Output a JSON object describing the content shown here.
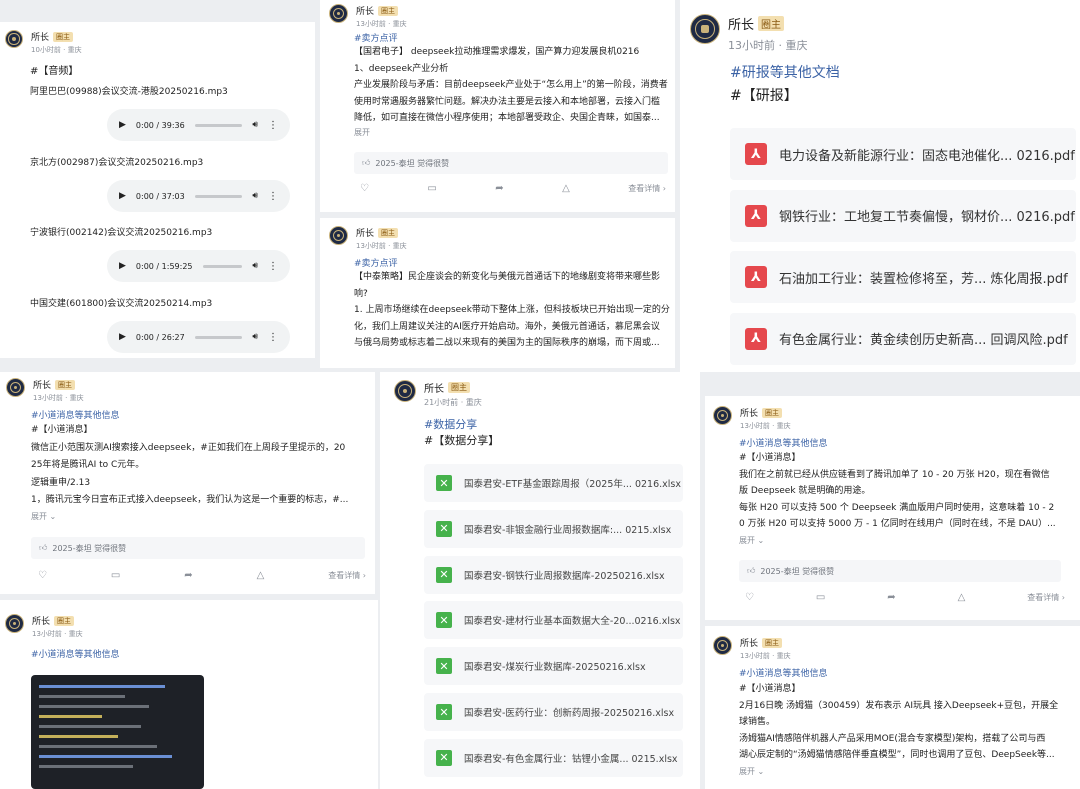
{
  "author": {
    "name": "所长",
    "badge": "圈主"
  },
  "card1": {
    "time": "10小时前 · 重庆",
    "heading": "#【音频】",
    "audios": [
      {
        "file": "阿里巴巴(09988)会议交流-港股20250216.mp3",
        "time": "0:00 / 39:36"
      },
      {
        "file": "京北方(002987)会议交流20250216.mp3",
        "time": "0:00 / 37:03"
      },
      {
        "file": "宁波银行(002142)会议交流20250216.mp3",
        "time": "0:00 / 1:59:25"
      },
      {
        "file": "中国交建(601800)会议交流20250214.mp3",
        "time": "0:00 / 26:27"
      }
    ]
  },
  "card2": {
    "time": "13小时前 · 重庆",
    "tag": "#卖方点评",
    "lines": [
      "【国君电子】 deepseek拉动推理需求爆发，国产算力迎发展良机0216",
      "1、deepseek产业分析",
      "产业发展阶段与矛盾：目前deepseek产业处于“怎么用上”的第一阶段，消费者",
      "使用时常遇服务器繁忙问题。解决办法主要是云接入和本地部署，云接入门槛",
      "降低，如可直接在微信小程序使用；本地部署受政企、央国企青睐，如国泰..."
    ],
    "more": "展开",
    "like": "2025-泰坦 觉得很赞",
    "detail": "查看详情"
  },
  "card3": {
    "time": "13小时前 · 重庆",
    "tag": "#卖方点评",
    "lines": [
      "【中泰策略】民企座谈会的新变化与美俄元首通话下的地缘剧变将带来哪些影",
      "响?",
      "1. 上周市场继续在deepseek带动下整体上涨，但科技板块已开始出现一定的分",
      "化，我们上周建议关注的AI医疗开始启动。海外，美俄元首通话，慕尼黑会议",
      "与俄乌局势或标志着二战以来现有的美国为主的国际秩序的崩塌，而下周或..."
    ]
  },
  "card4": {
    "time": "13小时前 · 重庆",
    "tag": "#研报等其他文档",
    "heading": "#【研报】",
    "pdfs": [
      "电力设备及新能源行业：固态电池催化... 0216.pdf",
      "钢铁行业：工地复工节奏偏慢，钢材价... 0216.pdf",
      "石油加工行业：装置检修将至，芳... 炼化周报.pdf",
      "有色金属行业：黄金续创历史新高... 回调风险.pdf"
    ]
  },
  "card5": {
    "time": "13小时前 · 重庆",
    "tag": "#小道消息等其他信息",
    "lines": [
      "#【小道消息】",
      "微信正小范围灰测AI搜索接入deepseek，#正如我们在上周段子里提示的，20",
      "25年将是腾讯AI to C元年。",
      "逻辑重申/2.13",
      "1，腾讯元宝今日宣布正式接入deepseek，我们认为这是一个重要的标志，#..."
    ],
    "more": "展开",
    "like": "2025-泰坦 觉得很赞",
    "detail": "查看详情"
  },
  "card6": {
    "time": "21小时前 · 重庆",
    "tag": "#数据分享",
    "heading": "#【数据分享】",
    "files": [
      "国泰君安-ETF基金跟踪周报（2025年... 0216.xlsx",
      "国泰君安-非银金融行业周报数据库:... 0215.xlsx",
      "国泰君安-钢铁行业周报数据库-20250216.xlsx",
      "国泰君安-建材行业基本面数据大全-20...0216.xlsx",
      "国泰君安-煤炭行业数据库-20250216.xlsx",
      "国泰君安-医药行业：创新药周报-20250216.xlsx",
      "国泰君安-有色金属行业：钴锂小金属... 0215.xlsx"
    ]
  },
  "card7": {
    "time": "13小时前 · 重庆",
    "tag": "#小道消息等其他信息",
    "lines": [
      "#【小道消息】",
      "我们在之前就已经从供应链看到了腾讯加单了 10 - 20 万张 H20，现在看微信",
      "版 Deepseek 就是明确的用途。",
      "每张 H20 可以支持 500 个 Deepseek 满血版用户同时使用，这意味着 10 - 2",
      "0 万张 H20 可以支持 5000 万 - 1 亿同时在线用户（同时在线，不是 DAU）..."
    ],
    "more": "展开",
    "like": "2025-泰坦 觉得很赞",
    "detail": "查看详情"
  },
  "card8": {
    "time": "13小时前 · 重庆",
    "tag": "#小道消息等其他信息"
  },
  "card9": {
    "time": "13小时前 · 重庆",
    "tag": "#小道消息等其他信息",
    "lines": [
      "#【小道消息】",
      "2月16日晚 汤姆猫（300459）发布表示 AI玩具 接入Deepseek+豆包，开展全",
      "球销售。",
      "汤姆猫AI情感陪伴机器人产品采用MOE(混合专家模型)架构，搭载了公司与西",
      "湖心辰定制的“汤姆猫情感陪伴垂直模型”，同时也调用了豆包、DeepSeek等..."
    ],
    "more": "展开"
  }
}
